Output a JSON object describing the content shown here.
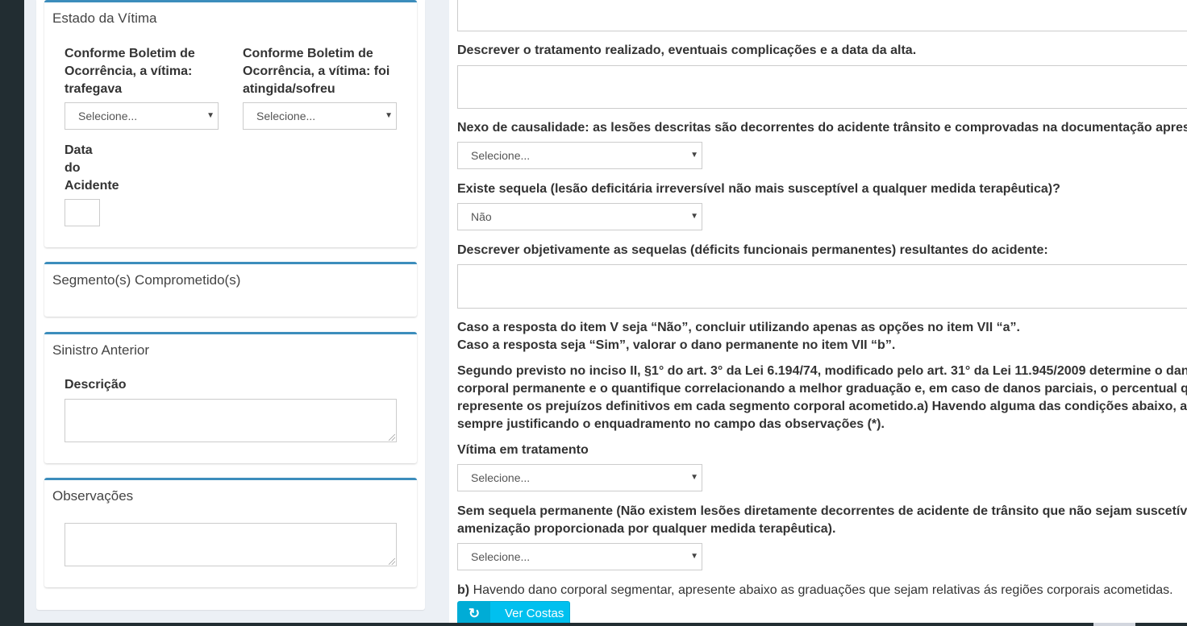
{
  "left_panel": {
    "estado": {
      "title": "Estado da Vítima",
      "field1_label": "Conforme Boletim de Ocorrência, a vítima: trafegava",
      "field1_value": "Selecione...",
      "field2_label": "Conforme Boletim de Ocorrência, a vítima: foi atingida/sofreu",
      "field2_value": "Selecione...",
      "date_label_1": "Data",
      "date_label_2": "do",
      "date_label_3": "Acidente",
      "date_value": ""
    },
    "segmentos": {
      "title": "Segmento(s) Comprometido(s)"
    },
    "sinistro": {
      "title": "Sinistro Anterior",
      "descricao_label": "Descrição"
    },
    "observacoes": {
      "title": "Observações"
    }
  },
  "main": {
    "tratamento_label": "Descrever o tratamento realizado, eventuais complicações e a data da alta.",
    "nexo_label": "Nexo de causalidade: as lesões descritas são decorrentes do acidente trânsito e comprovadas na documentação apres",
    "nexo_value": "Selecione...",
    "sequela_label": "Existe sequela (lesão deficitária irreversível não mais susceptível a qualquer medida terapêutica)?",
    "sequela_value": "Não",
    "descrever_sequelas_label": "Descrever objetivamente as sequelas (déficits funcionais permanentes) resultantes do acidente:",
    "instr_line1": "Caso a resposta do item V seja “Não”, concluir utilizando apenas as opções no item VII “a”.",
    "instr_line2": "Caso a resposta seja “Sim”, valorar o dano permanente no item VII “b”.",
    "lei_line1": "Segundo previsto no inciso II, §1° do art. 3° da Lei 6.194/74, modificado pelo art. 31° da Lei 11.945/2009 determine o dan",
    "lei_line2": "corporal permanente e o quantifique correlacionando a melhor graduação e, em caso de danos parciais, o percentual q",
    "lei_line3": "represente os prejuízos definitivos em cada segmento corporal acometido.a) Havendo alguma das condições abaixo, a",
    "lei_line4": "sempre justificando o enquadramento no campo das observações (*).",
    "vitima_tratamento_label": "Vítima em tratamento",
    "vitima_tratamento_value": "Selecione...",
    "sem_sequela_line1": "Sem sequela permanente (Não existem lesões diretamente decorrentes de acidente de trânsito que não sejam suscetív",
    "sem_sequela_line2": "amenização proporcionada por qualquer medida terapêutica).",
    "sem_sequela_value": "Selecione...",
    "b_prefix": "b)",
    "b_text": "Havendo dano corporal segmentar, apresente abaixo as graduações que sejam relativas ás regiões corporais acometidas.",
    "ver_costas_label": "Ver Costas",
    "ver_costas_icon": "refresh-icon"
  },
  "colors": {
    "box_border": "#3c8dbc",
    "button_bg": "#00c0ef",
    "sidebar_bg": "#222d32",
    "content_bg": "#ecf0f5"
  }
}
